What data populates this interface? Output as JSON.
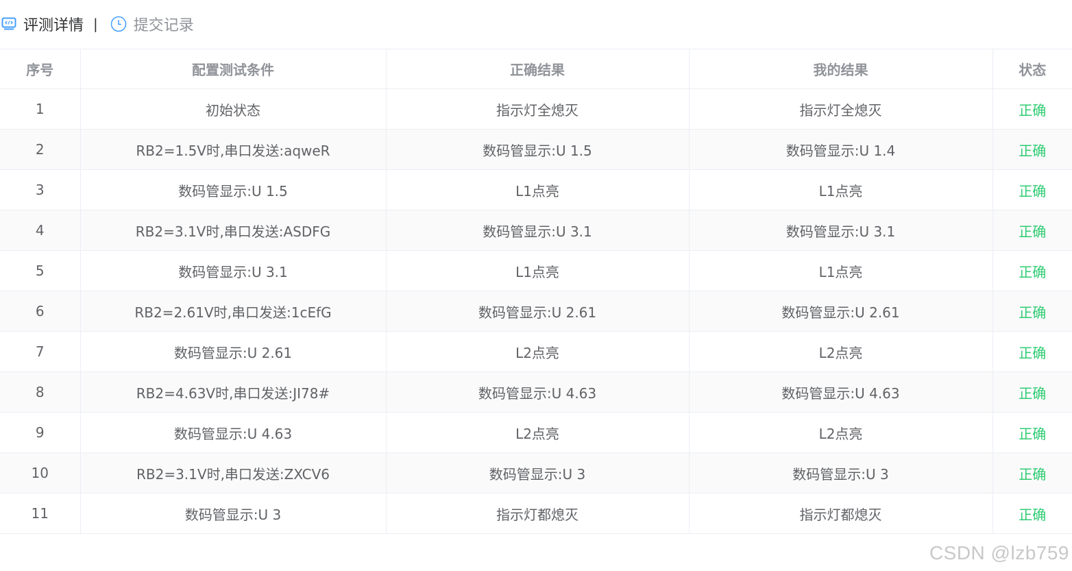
{
  "tabs": {
    "active": {
      "label": "评测详情",
      "icon": "code-monitor-icon"
    },
    "separator": "|",
    "inactive": {
      "label": "提交记录",
      "icon": "clock-icon"
    }
  },
  "colors": {
    "accent": "#409eff",
    "status_ok": "#2ecc71",
    "header_text": "#909399",
    "cell_text": "#606266"
  },
  "table": {
    "headers": {
      "index": "序号",
      "condition": "配置测试条件",
      "expected": "正确结果",
      "mine": "我的结果",
      "status": "状态"
    },
    "rows": [
      {
        "index": "1",
        "condition": "初始状态",
        "expected": "指示灯全熄灭",
        "mine": "指示灯全熄灭",
        "status": "正确"
      },
      {
        "index": "2",
        "condition": "RB2=1.5V时,串口发送:aqweR",
        "expected": "数码管显示:U 1.5",
        "mine": "数码管显示:U 1.4",
        "status": "正确"
      },
      {
        "index": "3",
        "condition": "数码管显示:U 1.5",
        "expected": "L1点亮",
        "mine": "L1点亮",
        "status": "正确"
      },
      {
        "index": "4",
        "condition": "RB2=3.1V时,串口发送:ASDFG",
        "expected": "数码管显示:U 3.1",
        "mine": "数码管显示:U 3.1",
        "status": "正确"
      },
      {
        "index": "5",
        "condition": "数码管显示:U 3.1",
        "expected": "L1点亮",
        "mine": "L1点亮",
        "status": "正确"
      },
      {
        "index": "6",
        "condition": "RB2=2.61V时,串口发送:1cEfG",
        "expected": "数码管显示:U 2.61",
        "mine": "数码管显示:U 2.61",
        "status": "正确"
      },
      {
        "index": "7",
        "condition": "数码管显示:U 2.61",
        "expected": "L2点亮",
        "mine": "L2点亮",
        "status": "正确"
      },
      {
        "index": "8",
        "condition": "RB2=4.63V时,串口发送:JI78#",
        "expected": "数码管显示:U 4.63",
        "mine": "数码管显示:U 4.63",
        "status": "正确"
      },
      {
        "index": "9",
        "condition": "数码管显示:U 4.63",
        "expected": "L2点亮",
        "mine": "L2点亮",
        "status": "正确"
      },
      {
        "index": "10",
        "condition": "RB2=3.1V时,串口发送:ZXCV6",
        "expected": "数码管显示:U 3",
        "mine": "数码管显示:U 3",
        "status": "正确"
      },
      {
        "index": "11",
        "condition": "数码管显示:U 3",
        "expected": "指示灯都熄灭",
        "mine": "指示灯都熄灭",
        "status": "正确"
      }
    ]
  },
  "watermark": "CSDN @lzb759"
}
